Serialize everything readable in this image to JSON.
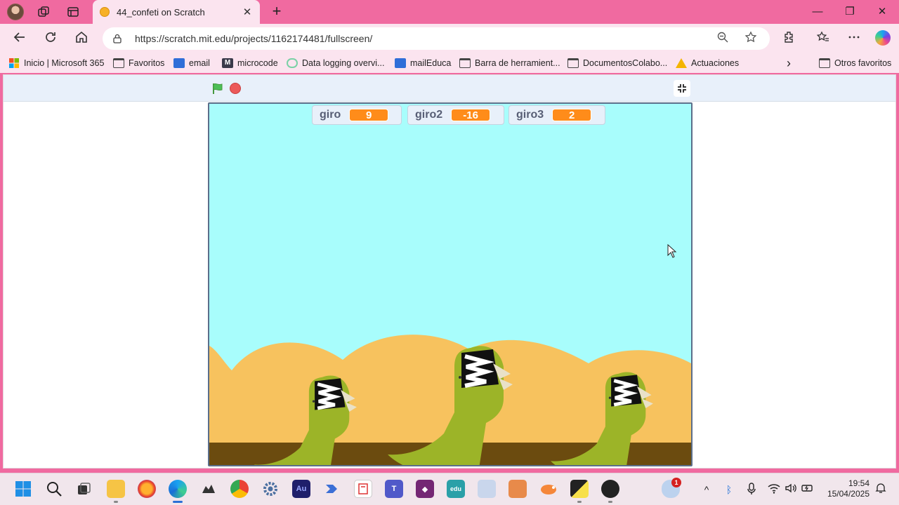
{
  "browser": {
    "tab": {
      "title": "44_confeti on Scratch",
      "close_glyph": "✕"
    },
    "new_tab_glyph": "+",
    "window_controls": {
      "minimize": "—",
      "restore": "❐",
      "close": "✕"
    },
    "address": {
      "url": "https://scratch.mit.edu/projects/1162174481/fullscreen/"
    },
    "bookmarks": [
      {
        "label": "Inicio | Microsoft 365",
        "icon": "microsoft-365-icon"
      },
      {
        "label": "Favoritos",
        "icon": "folder-icon"
      },
      {
        "label": "email",
        "icon": "mail-icon"
      },
      {
        "label": "microcode",
        "icon": "microcode-icon"
      },
      {
        "label": "Data logging overvi...",
        "icon": "link-icon"
      },
      {
        "label": "mailEduca",
        "icon": "mail-icon"
      },
      {
        "label": "Barra de herramient...",
        "icon": "folder-icon"
      },
      {
        "label": "DocumentosColabo...",
        "icon": "folder-icon"
      },
      {
        "label": "Actuaciones",
        "icon": "google-drive-icon"
      },
      {
        "label": "Otros favoritos",
        "icon": "folder-icon"
      }
    ],
    "bookmarks_more_glyph": "›"
  },
  "scratch": {
    "monitors": [
      {
        "label": "giro",
        "value": "9"
      },
      {
        "label": "giro2",
        "value": "-16"
      },
      {
        "label": "giro3",
        "value": "2"
      }
    ],
    "colors": {
      "sky": "#a8fdfc",
      "hills": "#f7c25e",
      "ground": "#6b4b0f",
      "dino": "#9cb428",
      "monitor_value": "#ff8c1a"
    }
  },
  "taskbar": {
    "apps": [
      "windows-start-icon",
      "search-icon",
      "task-view-icon",
      "file-explorer-icon",
      "firefox-icon",
      "edge-icon",
      "inkscape-icon",
      "chrome-icon",
      "settings-icon",
      "audition-icon",
      "power-automate-icon",
      "forms-icon",
      "teams-icon",
      "power-apps-icon",
      "edu-icon",
      "remote-icon",
      "jamboard-icon",
      "scratch-icon",
      "sticky-icon",
      "obs-icon"
    ],
    "audition_label": "Au",
    "edu_label": "edu",
    "weather_badge": "1",
    "time": "19:54",
    "date": "15/04/2025"
  }
}
